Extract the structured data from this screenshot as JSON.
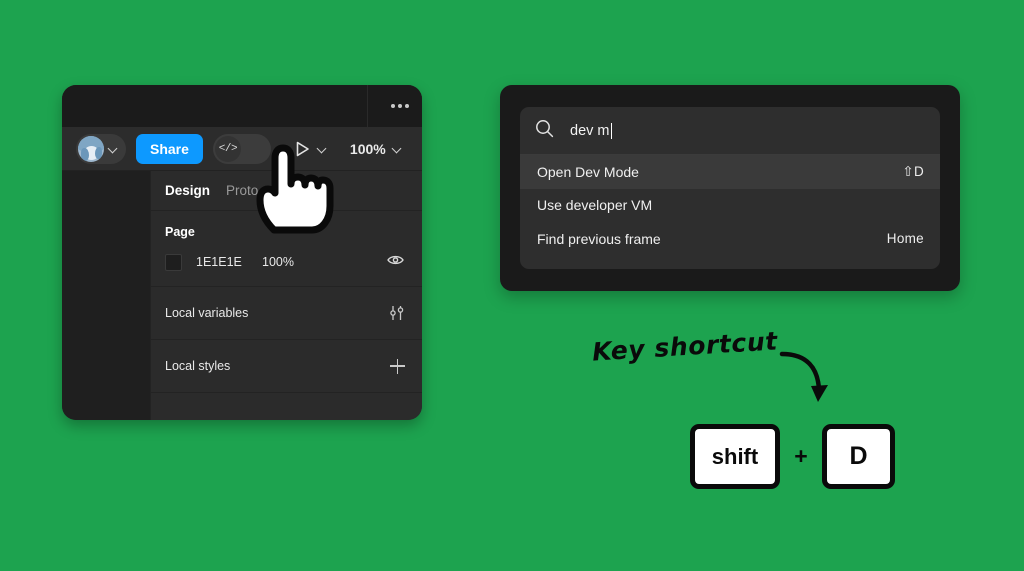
{
  "background_color": "#1da34f",
  "figma_panel": {
    "header": {
      "more_menu_label": "…",
      "more_menu_icon": "ellipsis-horizontal-icon"
    },
    "toolbar": {
      "avatar_icon": "user-avatar",
      "avatar_chevron_icon": "chevron-down-icon",
      "share_label": "Share",
      "devmode_toggle_icon": "code-brackets-icon",
      "devmode_toggle_label": "</>",
      "devmode_toggle_state": "off",
      "present_icon": "play-triangle-icon",
      "present_chevron_icon": "chevron-down-icon",
      "zoom_label": "100%",
      "zoom_chevron_icon": "chevron-down-icon",
      "accent_color": "#0d99ff"
    },
    "tabs": [
      {
        "label": "Design",
        "active": true
      },
      {
        "label": "Proto",
        "active": false
      }
    ],
    "page_section": {
      "title": "Page",
      "swatch_color": "#1e1e1e",
      "hex": "1E1E1E",
      "opacity": "100%",
      "visibility_icon": "eye-icon"
    },
    "rows": [
      {
        "label": "Local variables",
        "icon": "sliders-icon"
      },
      {
        "label": "Local styles",
        "icon": "plus-icon"
      }
    ]
  },
  "command_palette": {
    "search": {
      "icon": "search-icon",
      "value": "dev m",
      "placeholder": "Search"
    },
    "results": [
      {
        "label": "Open Dev Mode",
        "shortcut": "⇧D",
        "selected": true
      },
      {
        "label": "Use developer VM",
        "shortcut": "",
        "selected": false
      },
      {
        "label": "Find previous frame",
        "shortcut": "Home",
        "selected": false
      }
    ]
  },
  "annotation": {
    "text": "Key shortcut",
    "arrow_icon": "curved-arrow-icon"
  },
  "keyboard_shortcut": {
    "keys": [
      "shift",
      "D"
    ],
    "separator": "+"
  },
  "pointer": {
    "icon": "pointing-hand-cursor"
  }
}
